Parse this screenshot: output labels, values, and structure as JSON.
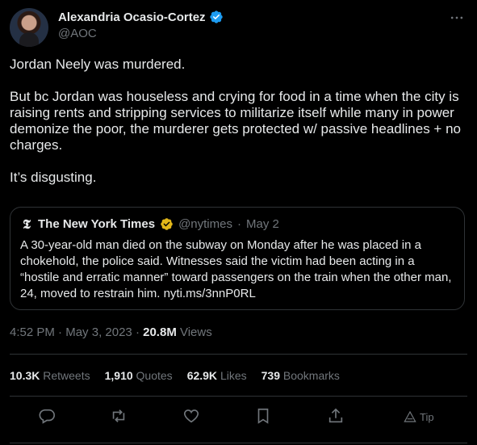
{
  "author": {
    "display_name": "Alexandria Ocasio-Cortez",
    "handle": "@AOC"
  },
  "tweet": {
    "paragraphs": [
      "Jordan Neely was murdered.",
      "But bc Jordan was houseless and crying for food in a time when the city is raising rents and stripping services to militarize itself while many in power demonize the poor, the murderer gets protected w/ passive headlines + no charges.",
      "It’s disgusting."
    ]
  },
  "quote": {
    "display_name": "The New York Times",
    "handle": "@nytimes",
    "separator": "·",
    "date": "May 2",
    "text": "A 30-year-old man died on the subway on Monday after he was placed in a chokehold, the police said. Witnesses said the victim had been acting in a “hostile and erratic manner” toward passengers on the train when the other man, 24, moved to restrain him. nyti.ms/3nnP0RL"
  },
  "meta": {
    "time": "4:52 PM",
    "separator": "·",
    "date": "May 3, 2023",
    "views_count": "20.8M",
    "views_label": " Views"
  },
  "stats": [
    {
      "count": "10.3K",
      "label": "Retweets"
    },
    {
      "count": "1,910",
      "label": "Quotes"
    },
    {
      "count": "62.9K",
      "label": "Likes"
    },
    {
      "count": "739",
      "label": "Bookmarks"
    }
  ],
  "actions": {
    "tip_label": "Tip"
  },
  "colors": {
    "background": "#000000",
    "text": "#e7e9ea",
    "muted": "#71767b",
    "border": "#2f3336",
    "verified_blue": "#1d9bf0",
    "verified_gold": "#e2b719"
  },
  "icons": [
    "verified-badge-icon",
    "more-icon",
    "nyt-logo-icon",
    "gold-check-icon",
    "reply-icon",
    "retweet-icon",
    "like-icon",
    "bookmark-icon",
    "share-icon",
    "tip-icon"
  ]
}
